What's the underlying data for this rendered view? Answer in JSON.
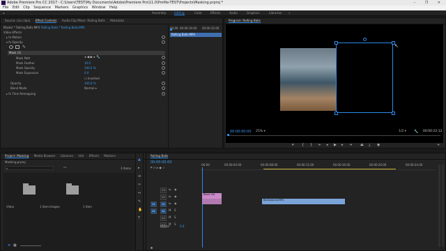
{
  "window": {
    "title": "Adobe Premiere Pro CC 2017 - C:\\Users\\TEST\\My Documents\\Adobe\\Premiere Pro\\11.0\\Profile-TEST\\Projects\\Masking.prproj *",
    "controls": "–  ❐  ✕"
  },
  "menu": [
    "File",
    "Edit",
    "Clip",
    "Sequence",
    "Markers",
    "Graphics",
    "Window",
    "Help"
  ],
  "workspaces": {
    "items": [
      "Assembly",
      "Editing",
      "Color",
      "Effects",
      "Audio",
      "Graphics",
      "Libraries"
    ],
    "active": "Editing",
    "more": "»"
  },
  "left_top_panel": {
    "tabs": [
      "Source: (no clips)",
      "Effect Controls",
      "Audio Clip Mixer: Rolling Balls",
      "Metadata"
    ],
    "active_tab": "Effect Controls",
    "clip_path": "Master * Rolling Balls.MP4",
    "clip_path2": "Rolling Balls * Rolling Balls.MP4",
    "section": "Video Effects",
    "rows": {
      "motion": "Motion",
      "opacity": "Opacity",
      "mask": "Mask (1)",
      "mask_path": "Mask Path",
      "mask_feather": "Mask Feather",
      "mask_feather_val": "10.0",
      "mask_opacity": "Mask Opacity",
      "mask_opacity_val": "100.0 %",
      "mask_expansion": "Mask Expansion",
      "mask_expansion_val": "0.0",
      "inverted": "Inverted",
      "opacity_prop": "Opacity",
      "opacity_val": "100.0 %",
      "blend_mode": "Blend Mode",
      "blend_val": "Normal",
      "time_remap": "Time Remapping"
    },
    "timeruler": {
      "t0": "00:00",
      "t1": "00:00:16:00",
      "t2": "00:00:32:00"
    },
    "clip_bar": "Rolling Balls.MP4"
  },
  "program": {
    "title": "Program: Rolling Balls",
    "timecode": "00:00:00:00",
    "zoom": "25%",
    "resolution": "1/2",
    "duration": "00:00:22:12"
  },
  "project": {
    "tabs": [
      "Project: Masking",
      "Media Browser",
      "Libraries",
      "Info",
      "Effects",
      "Markers"
    ],
    "active_tab": "Project: Masking",
    "file": "Masking.prproj",
    "count": "3 Items",
    "bins": [
      {
        "name": "Video",
        "meta": "1 Item"
      },
      {
        "name": "Images",
        "meta": "1 Item"
      }
    ]
  },
  "timeline": {
    "tab": "Rolling Balls",
    "timecode": "00:00:00:00",
    "ruler": [
      ":00:00",
      "00:00:04:00",
      "00:00:08:00",
      "00:00:12:00",
      "00:00:16:00",
      "00:00:20:00",
      "00:00:24:00"
    ],
    "tracks": [
      {
        "src": "",
        "id": "V3"
      },
      {
        "src": "",
        "id": "V2"
      },
      {
        "src": "V1",
        "id": "V1"
      },
      {
        "src": "A1",
        "id": "A1"
      },
      {
        "src": "",
        "id": "A2"
      },
      {
        "src": "",
        "id": "A3"
      }
    ],
    "master_label": "Master",
    "master_val": "0.0",
    "clips": {
      "v2": "Black Vid",
      "v1": "Background.MP4"
    }
  },
  "colors": {
    "accent": "#2d8ceb",
    "panel": "#232323",
    "clip_pink": "#c98ac9",
    "clip_blue": "#7aa3d9"
  }
}
